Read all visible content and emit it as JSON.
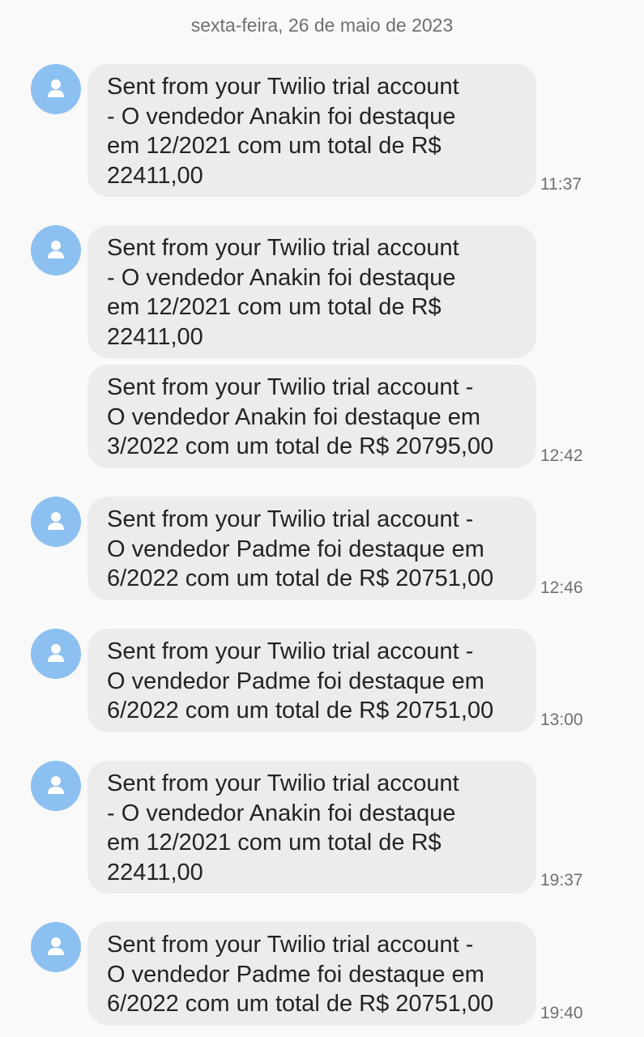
{
  "date_header": "sexta-feira, 26 de maio de 2023",
  "icons": {
    "avatar": "person-icon"
  },
  "colors": {
    "avatar": "#8cc0f0",
    "bubble": "#ececec",
    "background": "#f9f9f9"
  },
  "messages": [
    {
      "text": "Sent from your Twilio trial account\n- O vendedor Anakin foi destaque\nem 12/2021 com um total de R$\n22411,00",
      "time": "11:37"
    },
    {
      "text": "Sent from your Twilio trial account\n- O vendedor Anakin foi destaque\nem 12/2021 com um total de R$\n22411,00",
      "time": ""
    },
    {
      "text": "Sent from your Twilio trial account -\nO vendedor Anakin foi destaque em\n3/2022 com um total de R$ 20795,00",
      "time": "12:42"
    },
    {
      "text": "Sent from your Twilio trial account -\nO vendedor Padme foi destaque em\n6/2022 com um total de R$ 20751,00",
      "time": "12:46"
    },
    {
      "text": "Sent from your Twilio trial account -\nO vendedor Padme foi destaque em\n6/2022 com um total de R$ 20751,00",
      "time": "13:00"
    },
    {
      "text": "Sent from your Twilio trial account\n- O vendedor Anakin foi destaque\nem 12/2021 com um total de R$\n22411,00",
      "time": "19:37"
    },
    {
      "text": "Sent from your Twilio trial account -\nO vendedor Padme foi destaque em\n6/2022 com um total de R$ 20751,00",
      "time": "19:40"
    }
  ]
}
